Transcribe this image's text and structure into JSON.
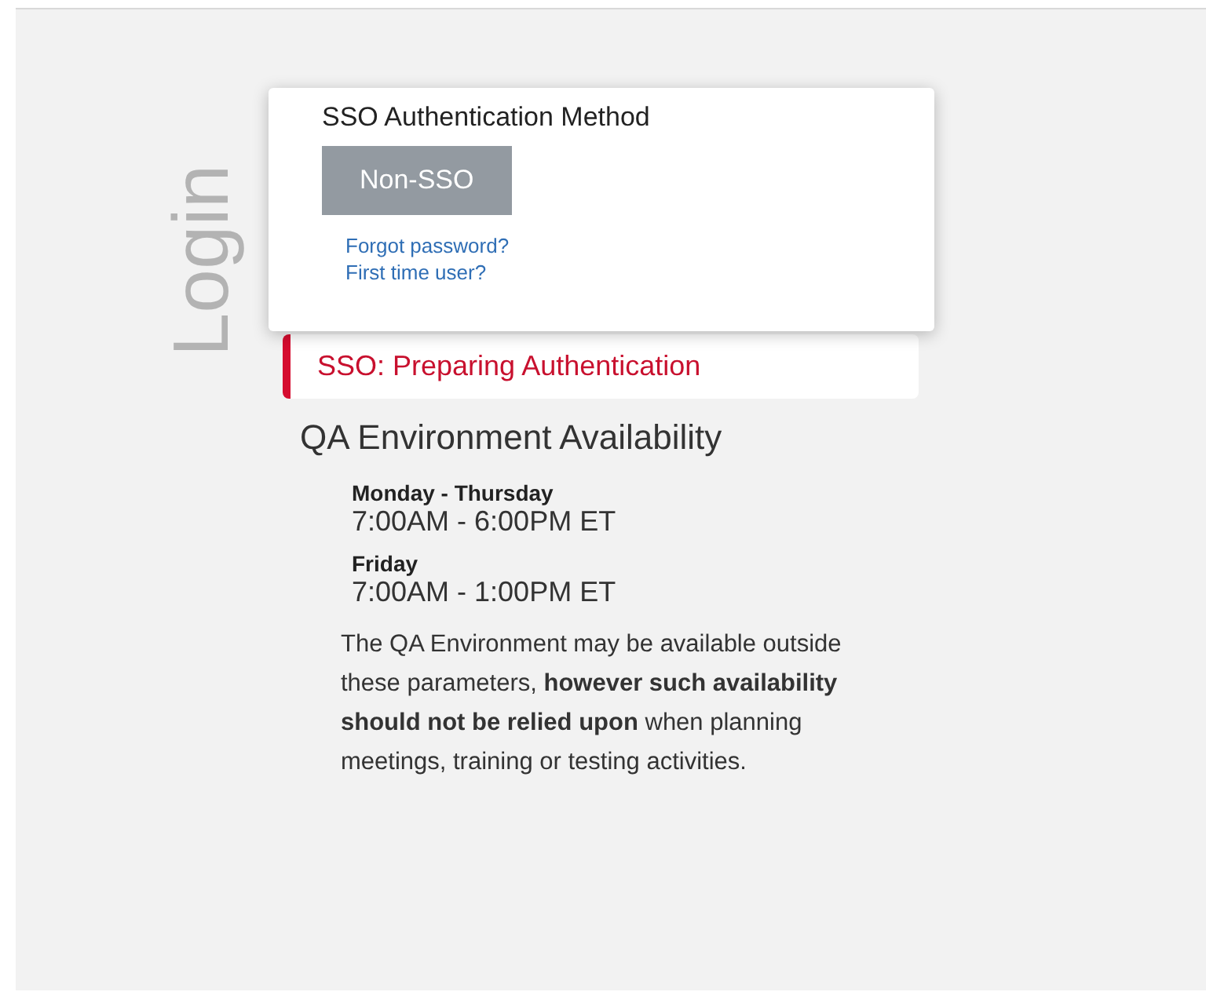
{
  "side_title": "Login",
  "auth_popup": {
    "title": "SSO Authentication Method",
    "button": "Non-SSO",
    "links": [
      "Forgot password?",
      "First time user?"
    ]
  },
  "status": {
    "text": "SSO: Preparing Authentication"
  },
  "availability": {
    "title": "QA Environment Availability",
    "schedule": [
      {
        "days": "Monday - Thursday",
        "hours": "7:00AM - 6:00PM ET"
      },
      {
        "days": "Friday",
        "hours": "7:00AM - 1:00PM ET"
      }
    ],
    "note": "The QA Environment may be available outside these parameters, **however such availability should not be relied upon** when planning meetings, training or testing activities."
  }
}
